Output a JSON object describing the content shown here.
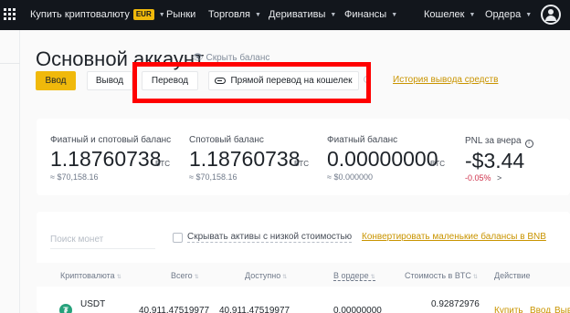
{
  "topbar": {
    "buy_crypto": "Купить криптовалюту",
    "buy_crypto_badge": "EUR",
    "markets": "Рынки",
    "trade": "Торговля",
    "derivatives": "Деривативы",
    "finance": "Финансы",
    "wallet": "Кошелек",
    "orders": "Ордера"
  },
  "header": {
    "title": "Основной аккаунт",
    "ghost_link": "Скрыть баланс"
  },
  "actions": {
    "deposit": "Ввод",
    "withdraw": "Вывод",
    "transfer": "Перевод",
    "direct_transfer": "Прямой перевод на кошелек",
    "withdraw_history": "История вывода средств"
  },
  "balances": [
    {
      "label": "Фиатный и спотовый баланс",
      "value": "1.18760738",
      "unit": "BTC",
      "approx": "≈ $70,158.16"
    },
    {
      "label": "Спотовый баланс",
      "value": "1.18760738",
      "unit": "BTC",
      "approx": "≈ $70,158.16"
    },
    {
      "label": "Фиатный баланс",
      "value": "0.00000000",
      "unit": "BTC",
      "approx": "≈ $0.000000"
    }
  ],
  "pnl": {
    "label": "PNL за вчера",
    "value": "-$3.44",
    "pct": "-0.05%",
    "arrow": ">"
  },
  "filters": {
    "search_placeholder": "Поиск монет",
    "hide_small": "Скрывать активы с низкой стоимостью",
    "convert_small": "Конвертировать маленькие балансы в BNB"
  },
  "table": {
    "headers": [
      "Криптовалюта",
      "Всего",
      "Доступно",
      "В ордере",
      "Стоимость в BTC",
      "Действие"
    ],
    "rows": [
      {
        "coin": "USDT",
        "total": "40,911.47519977",
        "available": "40,911.47519977",
        "in_order": "0.00000000",
        "btc_value": "0.92872976",
        "actions": [
          "Купить",
          "Ввод",
          "Вывод"
        ]
      }
    ]
  },
  "colors": {
    "topbar_bg": "#12161c",
    "accent": "#f0b90b",
    "link": "#c99400",
    "negative": "#cf304a",
    "highlight_box": "#ff0000"
  }
}
